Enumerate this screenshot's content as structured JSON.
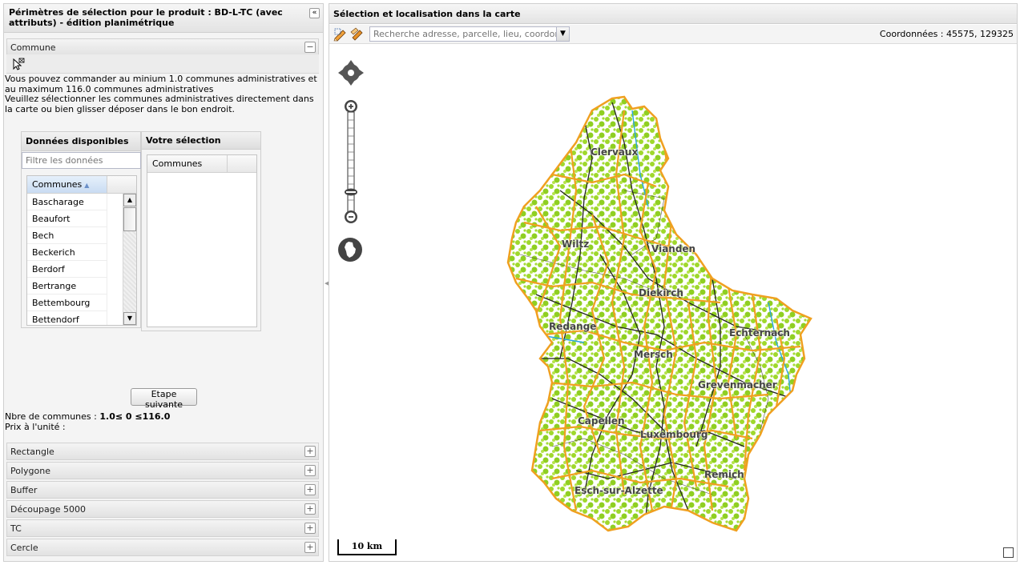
{
  "left_panel": {
    "title": "Périmètres de sélection pour le produit : BD-L-TC (avec attributs) - édition planimétrique",
    "collapse_icon": "double-chevron-left-icon",
    "commune_section": {
      "label": "Commune",
      "toggle": "−",
      "info_text": "Vous pouvez commander au minium 1.0 communes administratives et au maximum 116.0 communes administratives\nVeuillez sélectionner les communes administratives directement dans la carte ou bien glisser déposer dans le bon endroit.",
      "available": {
        "title": "Données disponibles",
        "filter_placeholder": "Filtre les données",
        "column": "Communes",
        "rows": [
          "Bascharage",
          "Beaufort",
          "Bech",
          "Beckerich",
          "Berdorf",
          "Bertrange",
          "Bettembourg",
          "Bettendorf"
        ]
      },
      "selection": {
        "title": "Votre sélection",
        "column": "Communes"
      },
      "next_button": "Etape suivante",
      "count_label": "Nbre de communes : ",
      "count_value": "1.0≤ 0 ≤116.0",
      "price_label": "Prix à l'unité :"
    },
    "sections": [
      {
        "label": "Rectangle"
      },
      {
        "label": "Polygone"
      },
      {
        "label": "Buffer"
      },
      {
        "label": "Découpage 5000"
      },
      {
        "label": "TC"
      },
      {
        "label": "Cercle"
      }
    ],
    "expand_symbol": "+"
  },
  "right_panel": {
    "title": "Sélection et localisation dans la carte",
    "search_placeholder": "Recherche adresse, parcelle, lieu, coordonnÃ(",
    "coords": "Coordonnées : 45575, 129325",
    "scale_label": "10 km",
    "towns": [
      "Clervaux",
      "Wiltz",
      "Vianden",
      "Diekirch",
      "Redange",
      "Echternach",
      "Mersch",
      "Grevenmacher",
      "Capellen",
      "Luxembourg",
      "Esch-sur-Alzette",
      "Remich"
    ],
    "colors": {
      "border_orange": "#f0a020",
      "land_green": "#9fd82c",
      "road_black": "#222222",
      "water_blue": "#2aa6e0"
    }
  }
}
